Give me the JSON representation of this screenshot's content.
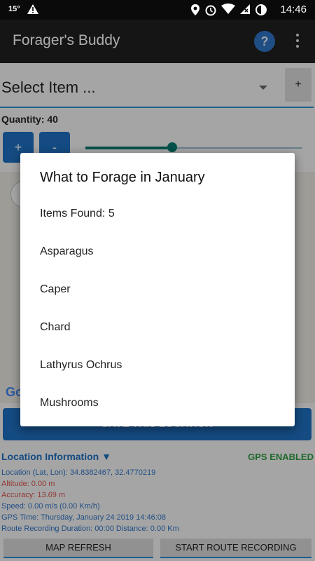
{
  "statusbar": {
    "temp": "15°",
    "time": "14:46"
  },
  "app": {
    "title": "Forager's Buddy",
    "help": "?"
  },
  "spinner": {
    "label": "Select Item ...",
    "add": "+"
  },
  "quantity": {
    "label": "Quantity: 40",
    "plus": "+",
    "minus": "-",
    "slider_fraction": 0.4
  },
  "map": {
    "google": "Google"
  },
  "save_button": "SAVE THIS LOCATION",
  "location": {
    "header": "Location Information ▼",
    "gps_status": "GPS ENABLED",
    "lines": [
      {
        "text": "Location (Lat, Lon): 34.8382467, 32.4770219",
        "color": "#2f73c3"
      },
      {
        "text": "Altitude: 0.00 m",
        "color": "#d9534f"
      },
      {
        "text": "Accuracy: 13.69 m",
        "color": "#d9534f"
      },
      {
        "text": "Speed: 0.00 m/s (0.00 Km/h)",
        "color": "#2f73c3"
      },
      {
        "text": "GPS Time: Thursday, January 24 2019 14:46:08",
        "color": "#2f73c3"
      },
      {
        "text": "Route Recording Duration: 00:00 Distance: 0.00 Km",
        "color": "#2f73c3"
      }
    ]
  },
  "bottom": {
    "map_refresh": "MAP REFRESH",
    "route": "START ROUTE RECORDING"
  },
  "dialog": {
    "title": "What to Forage in January",
    "items_found": "Items Found: 5",
    "items": [
      "Asparagus",
      "Caper",
      "Chard",
      "Lathyrus Ochrus",
      "Mushrooms"
    ]
  }
}
